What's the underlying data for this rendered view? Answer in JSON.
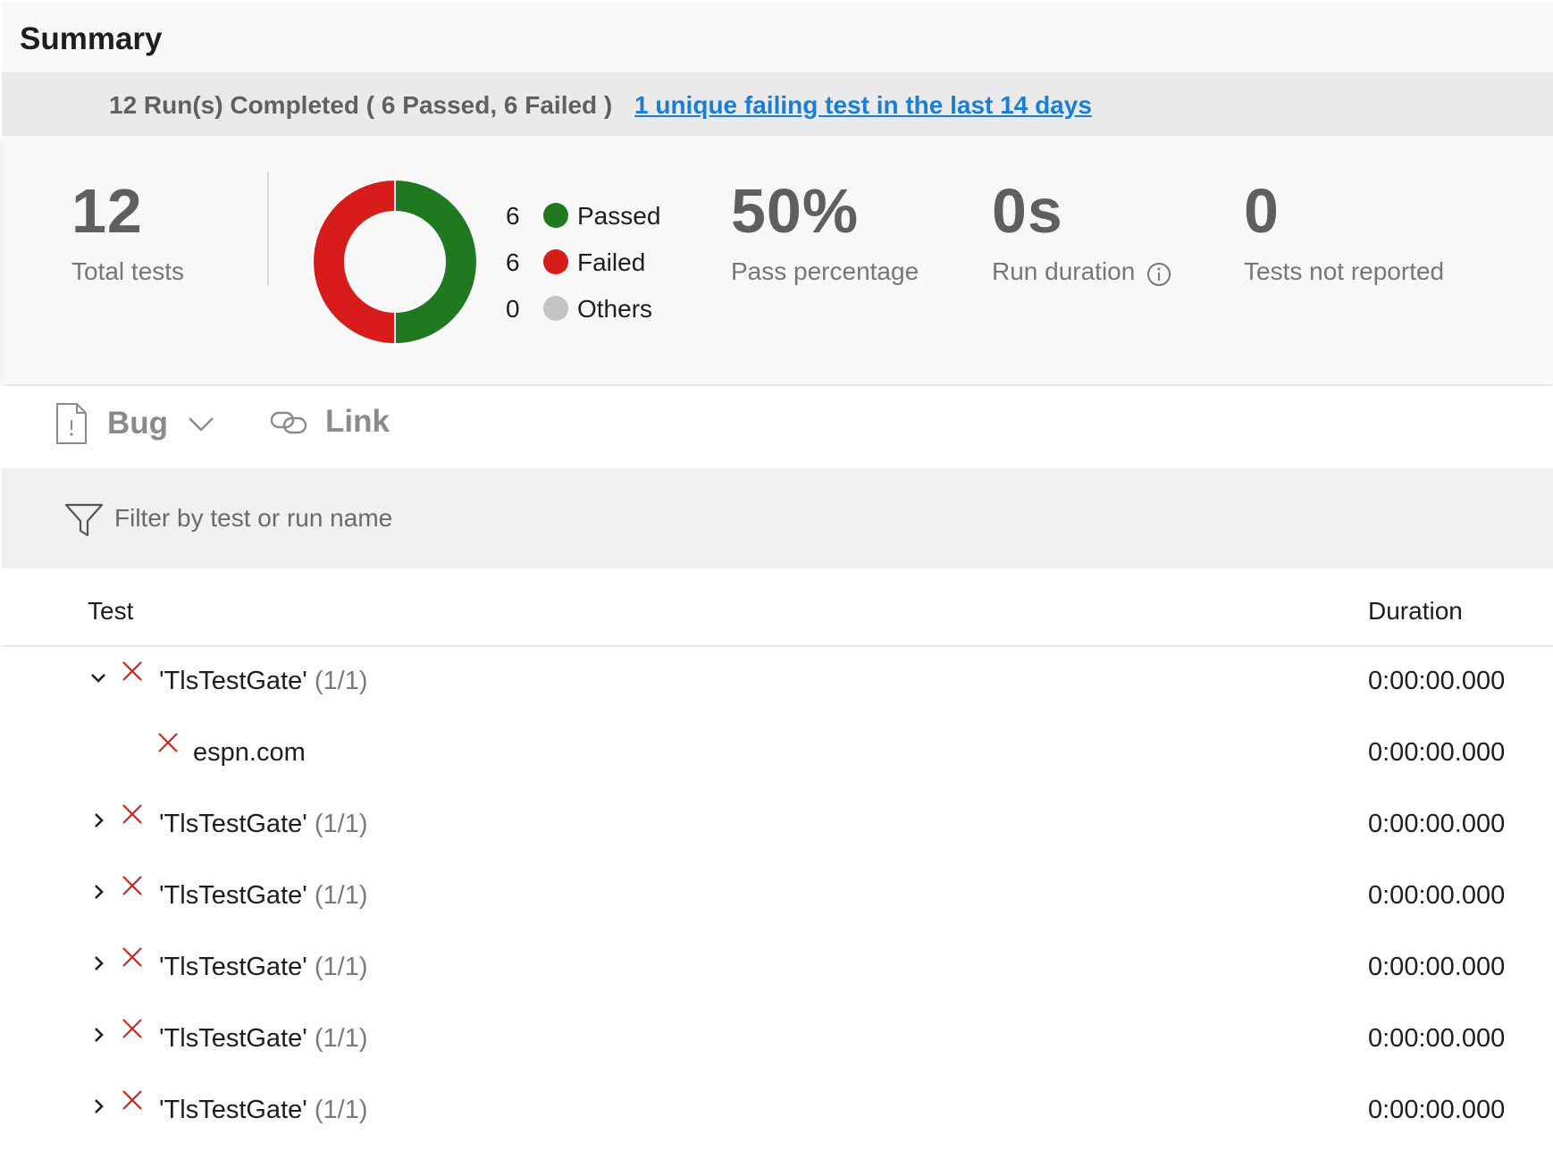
{
  "summary": {
    "title": "Summary"
  },
  "run_summary": {
    "text": "12 Run(s) Completed ( 6 Passed, 6 Failed )",
    "link": "1 unique failing test in the last 14 days"
  },
  "stats": {
    "total_tests": {
      "value": "12",
      "label": "Total tests"
    },
    "pass_percentage": {
      "value": "50%",
      "label": "Pass percentage"
    },
    "run_duration": {
      "value": "0s",
      "label": "Run duration"
    },
    "not_reported": {
      "value": "0",
      "label": "Tests not reported"
    }
  },
  "chart_data": {
    "type": "pie",
    "categories": [
      "Passed",
      "Failed",
      "Others"
    ],
    "values": [
      6,
      6,
      0
    ],
    "colors": [
      "#1f7a1f",
      "#d81b1b",
      "#c4c4c4"
    ]
  },
  "legend": [
    {
      "count": "6",
      "label": "Passed",
      "color": "#1f7a1f"
    },
    {
      "count": "6",
      "label": "Failed",
      "color": "#d81b1b"
    },
    {
      "count": "0",
      "label": "Others",
      "color": "#c4c4c4"
    }
  ],
  "toolbar": {
    "bug_label": "Bug",
    "link_label": "Link",
    "bug_icon": "bug-document-icon",
    "link_icon": "link-icon"
  },
  "filter": {
    "placeholder": "Filter by test or run name",
    "value": ""
  },
  "table": {
    "columns": [
      "Test",
      "Duration"
    ],
    "rows": [
      {
        "name": "'TlsTestGate'",
        "count": "(1/1)",
        "duration": "0:00:00.000",
        "expanded": true,
        "status": "failed"
      },
      {
        "name": "espn.com",
        "count": "",
        "duration": "0:00:00.000",
        "child": true,
        "status": "failed"
      },
      {
        "name": "'TlsTestGate'",
        "count": "(1/1)",
        "duration": "0:00:00.000",
        "expanded": false,
        "status": "failed"
      },
      {
        "name": "'TlsTestGate'",
        "count": "(1/1)",
        "duration": "0:00:00.000",
        "expanded": false,
        "status": "failed"
      },
      {
        "name": "'TlsTestGate'",
        "count": "(1/1)",
        "duration": "0:00:00.000",
        "expanded": false,
        "status": "failed"
      },
      {
        "name": "'TlsTestGate'",
        "count": "(1/1)",
        "duration": "0:00:00.000",
        "expanded": false,
        "status": "failed"
      },
      {
        "name": "'TlsTestGate'",
        "count": "(1/1)",
        "duration": "0:00:00.000",
        "expanded": false,
        "status": "failed"
      }
    ]
  }
}
